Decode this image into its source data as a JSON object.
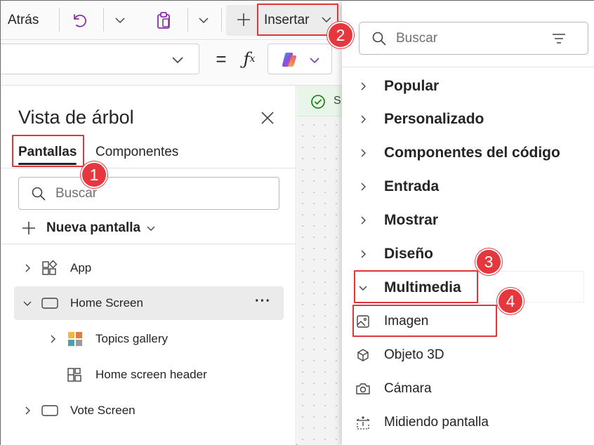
{
  "toolbar": {
    "back_label": "Atrás",
    "insert_label": "Insertar"
  },
  "tree": {
    "title": "Vista de árbol",
    "tabs": [
      {
        "label": "Pantallas",
        "active": true
      },
      {
        "label": "Componentes",
        "active": false
      }
    ],
    "search_placeholder": "Buscar",
    "new_screen_label": "Nueva pantalla",
    "nodes": [
      {
        "label": "App",
        "icon": "app-icon",
        "expandable": true,
        "expanded": false
      },
      {
        "label": "Home Screen",
        "icon": "screen-icon",
        "expandable": true,
        "expanded": true,
        "selected": true
      },
      {
        "label": "Topics gallery",
        "icon": "gallery-icon",
        "expandable": true,
        "expanded": false
      },
      {
        "label": "Home screen header",
        "icon": "container-icon",
        "expandable": false
      },
      {
        "label": "Vote Screen",
        "icon": "screen-icon",
        "expandable": true,
        "expanded": false
      }
    ]
  },
  "canvas": {
    "status_text": "S"
  },
  "insert_panel": {
    "search_placeholder": "Buscar",
    "categories": [
      {
        "label": "Popular",
        "expanded": false
      },
      {
        "label": "Personalizado",
        "expanded": false
      },
      {
        "label": "Componentes del código",
        "expanded": false
      },
      {
        "label": "Entrada",
        "expanded": false
      },
      {
        "label": "Mostrar",
        "expanded": false
      },
      {
        "label": "Diseño",
        "expanded": false
      },
      {
        "label": "Multimedia",
        "expanded": true
      }
    ],
    "multimedia_items": [
      {
        "label": "Imagen",
        "icon": "image-icon"
      },
      {
        "label": "Objeto 3D",
        "icon": "cube-icon"
      },
      {
        "label": "Cámara",
        "icon": "camera-icon"
      },
      {
        "label": "Midiendo pantalla",
        "icon": "measure-icon"
      }
    ]
  },
  "annotations": {
    "badges": [
      "1",
      "2",
      "3",
      "4"
    ],
    "color": "#e4383e"
  },
  "colors": {
    "accent": "#242424",
    "status_green": "#107c10",
    "copilot_purple": "#7a3dbd"
  }
}
